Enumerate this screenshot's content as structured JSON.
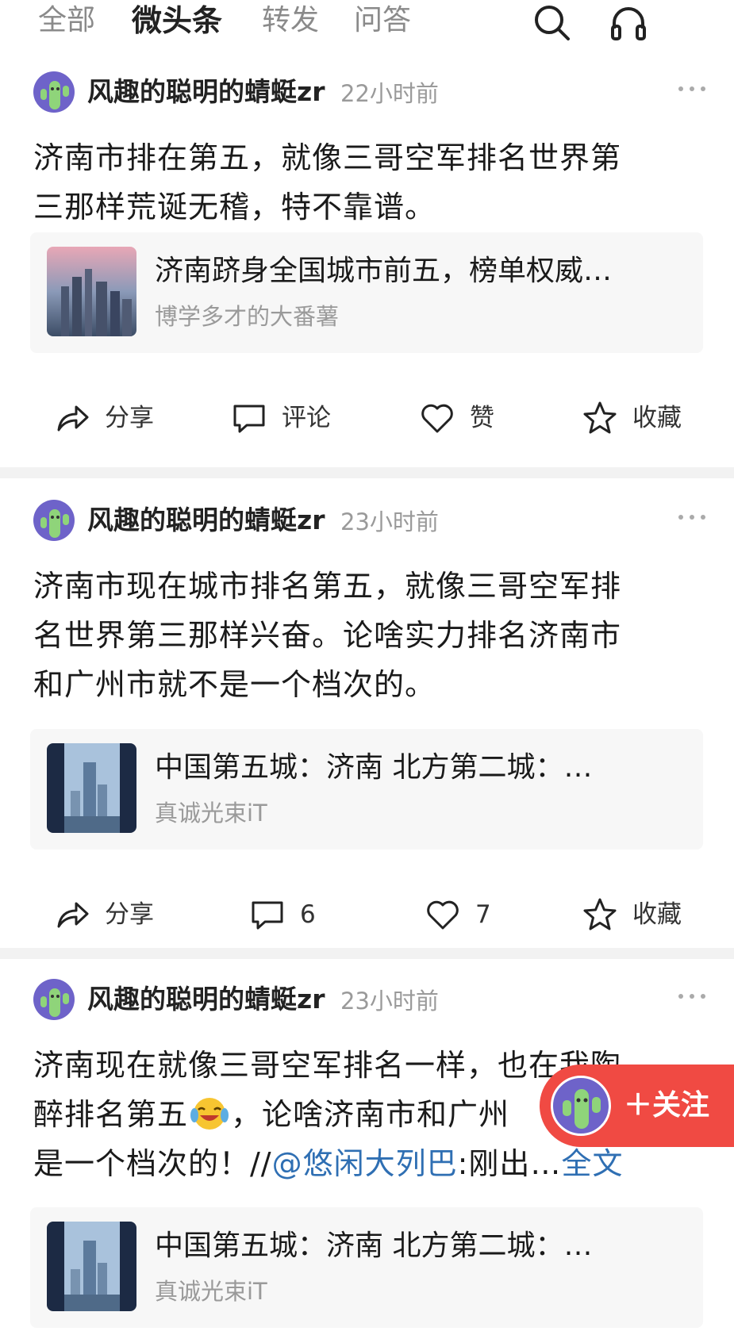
{
  "tabs": [
    {
      "label": "全部",
      "active": false
    },
    {
      "label": "微头条",
      "active": true
    },
    {
      "label": "转发",
      "active": false
    },
    {
      "label": "问答",
      "active": false
    }
  ],
  "icons": {
    "search": "search-icon",
    "listen": "headphones-icon"
  },
  "posts": [
    {
      "author": "风趣的聪明的蜻蜓zr",
      "time": "22小时前",
      "lines": [
        "济南市排在第五，就像三哥空军排名世界第",
        "三那样荒诞无稽，特不靠谱。"
      ],
      "card": {
        "title": "济南跻身全国城市前五，榜单权威…",
        "source": "博学多才的大番薯"
      },
      "actions": {
        "share": "分享",
        "comment": "评论",
        "like": "赞",
        "fav": "收藏"
      }
    },
    {
      "author": "风趣的聪明的蜻蜓zr",
      "time": "23小时前",
      "lines": [
        "济南市现在城市排名第五，就像三哥空军排",
        "名世界第三那样兴奋。论啥实力排名济南市",
        "和广州市就不是一个档次的。"
      ],
      "card": {
        "title": "中国第五城：济南 北方第二城：…",
        "source": "真诚光束iT"
      },
      "actions": {
        "share": "分享",
        "comment": "6",
        "like": "7",
        "fav": "收藏"
      }
    },
    {
      "author": "风趣的聪明的蜻蜓zr",
      "time": "23小时前",
      "lines": [
        "济南现在就像三哥空军排名一样，也在我陶",
        "醉排名第五",
        "，论啥济南市和广州"
      ],
      "line3_prefix": "是一个档次的！//",
      "mention": "@悠闲大列巴",
      "line3_suffix": ":刚出…",
      "full_text": "全文",
      "card": {
        "title": "中国第五城：济南 北方第二城：…",
        "source": "真诚光束iT"
      }
    }
  ],
  "follow_button": {
    "label": "＋关注"
  },
  "colors": {
    "accent_red": "#f04a43",
    "link_blue": "#2f6fb3",
    "avatar_purple": "#6e63c9"
  }
}
